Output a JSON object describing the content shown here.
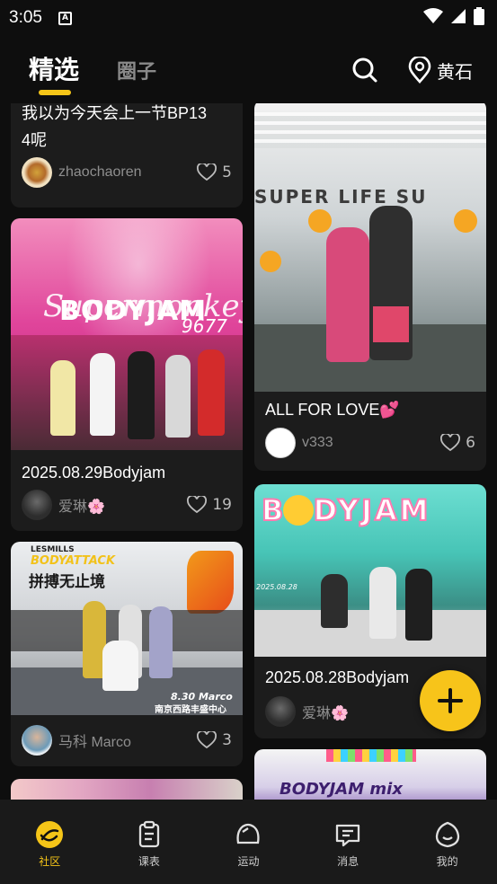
{
  "status_bar": {
    "time": "3:05",
    "notif_glyph": "A"
  },
  "header": {
    "tabs": [
      {
        "label": "精选",
        "active": true
      },
      {
        "label": "圈子",
        "active": false
      }
    ],
    "location": "黄石"
  },
  "posts": [
    {
      "title_line1": "我以为今天会上一节BP13",
      "title_line2": "4呢",
      "author": "zhaochaoren",
      "likes": "5"
    },
    {
      "title": "2025.08.29Bodyjam",
      "author": "爱琳🌸",
      "likes": "19"
    },
    {
      "title": "ALL FOR LOVE💕",
      "author": "v333",
      "likes": "6"
    },
    {
      "title": "2025.08.28Bodyjam",
      "author": "爱琳🌸"
    },
    {
      "title": "",
      "author": "马科 Marco",
      "likes": "3"
    }
  ],
  "image_text": {
    "bodyjam_sub": "9677",
    "les_mills": "LESMILLS",
    "bodyattack": "BODYATTACK",
    "slogan": "拼搏无止境",
    "marco_date": "8.30 Marco",
    "marco_place": "南京西路丰盛中心",
    "watermark": "2025.08.28"
  },
  "bottom_nav": [
    {
      "label": "社区",
      "active": true
    },
    {
      "label": "课表"
    },
    {
      "label": "运动"
    },
    {
      "label": "消息"
    },
    {
      "label": "我的"
    }
  ],
  "colors": {
    "accent": "#f5c518",
    "background": "#0e0e0e",
    "card": "#1c1c1c"
  }
}
